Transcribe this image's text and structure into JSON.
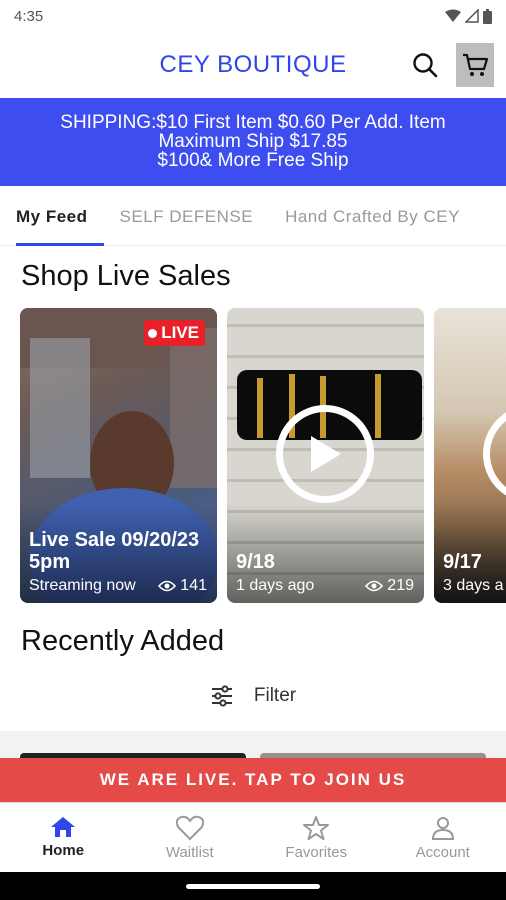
{
  "status_bar": {
    "time": "4:35"
  },
  "header": {
    "title": "CEY BOUTIQUE"
  },
  "shipping_banner": {
    "line1": "SHIPPING:$10 First Item $0.60  Per Add. Item",
    "line2": "Maximum Ship $17.85",
    "line3": "$100& More Free Ship"
  },
  "tabs": [
    {
      "label": "My Feed",
      "active": true
    },
    {
      "label": "SELF DEFENSE",
      "active": false
    },
    {
      "label": "Hand Crafted By CEY",
      "active": false
    }
  ],
  "live_sales": {
    "title": "Shop Live Sales",
    "cards": [
      {
        "badge": "LIVE",
        "title_line1": "Live Sale 09/20/23",
        "title_line2": "5pm",
        "subtitle": "Streaming now",
        "views": "141"
      },
      {
        "title_line1": "9/18",
        "subtitle": "1 days ago",
        "views": "219"
      },
      {
        "title_line1": "9/17",
        "subtitle": "3 days a"
      }
    ]
  },
  "recently_added": {
    "title": "Recently Added",
    "filter_label": "Filter"
  },
  "live_bar": {
    "label": "WE ARE LIVE. TAP TO JOIN US"
  },
  "bottom_nav": [
    {
      "label": "Home",
      "icon": "home-icon",
      "active": true
    },
    {
      "label": "Waitlist",
      "icon": "heart-icon",
      "active": false
    },
    {
      "label": "Favorites",
      "icon": "star-icon",
      "active": false
    },
    {
      "label": "Account",
      "icon": "account-icon",
      "active": false
    }
  ],
  "colors": {
    "accent": "#2f46e8",
    "banner": "#3d4df0",
    "live": "#e8202a",
    "live_bar": "#e34a48"
  }
}
